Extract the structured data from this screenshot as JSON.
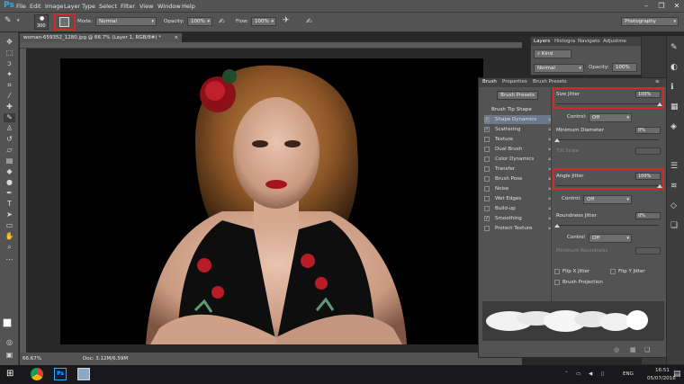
{
  "app": {
    "logo": "Ps",
    "workspace": "Photography",
    "accent": "#31a8ff"
  },
  "menu": [
    "File",
    "Edit",
    "Image",
    "Layer",
    "Type",
    "Select",
    "Filter",
    "View",
    "Window",
    "Help"
  ],
  "window_controls": {
    "minimize": "–",
    "restore": "❐",
    "close": "✕"
  },
  "options": {
    "brush_size": "300",
    "mode_label": "Mode:",
    "mode_value": "Normal",
    "opacity_label": "Opacity:",
    "opacity_value": "100%",
    "flow_label": "Flow:",
    "flow_value": "100%"
  },
  "document": {
    "tab_title": "woman-659352_1280.jpg @ 66.7% (Layer 1, RGB/8#) *",
    "tab_close": "×",
    "zoom": "66.67%",
    "doc_info": "Doc: 3.12M/6.59M"
  },
  "layers_panel": {
    "tabs": [
      "Layers",
      "Histogra",
      "Navigato",
      "Adjustme"
    ],
    "kind_label": "Kind",
    "blend_value": "Normal",
    "opacity_label": "Opacity:",
    "opacity_value": "100%"
  },
  "brush_panel": {
    "tabs": [
      "Brush",
      "Properties",
      "Brush Presets"
    ],
    "presets_button": "Brush Presets",
    "tip_shape_label": "Brush Tip Shape",
    "options": [
      {
        "label": "Shape Dynamics",
        "checked": "✓"
      },
      {
        "label": "Scattering",
        "checked": "✓"
      },
      {
        "label": "Texture",
        "checked": ""
      },
      {
        "label": "Dual Brush",
        "checked": ""
      },
      {
        "label": "Color Dynamics",
        "checked": ""
      },
      {
        "label": "Transfer",
        "checked": ""
      },
      {
        "label": "Brush Pose",
        "checked": ""
      },
      {
        "label": "Noise",
        "checked": ""
      },
      {
        "label": "Wet Edges",
        "checked": ""
      },
      {
        "label": "Build-up",
        "checked": ""
      },
      {
        "label": "Smoothing",
        "checked": "✓"
      },
      {
        "label": "Protect Texture",
        "checked": ""
      }
    ],
    "size_jitter_label": "Size Jitter",
    "size_jitter_value": "100%",
    "control_label": "Control:",
    "control_value": "Off",
    "min_diameter_label": "Minimum Diameter",
    "min_diameter_value": "0%",
    "tilt_scale_label": "Tilt Scale",
    "angle_jitter_label": "Angle Jitter",
    "angle_jitter_value": "100%",
    "angle_control_label": "Control:",
    "angle_control_value": "Off",
    "roundness_jitter_label": "Roundness Jitter",
    "roundness_jitter_value": "0%",
    "roundness_control_label": "Control",
    "roundness_control_value": "Off",
    "min_roundness_label": "Minimum Roundness",
    "flip_x_label": "Flip X Jitter",
    "flip_y_label": "Flip Y Jitter",
    "projection_label": "Brush Projection"
  },
  "taskbar": {
    "language": "ENG",
    "time": "16:51",
    "date": "05/07/2016"
  }
}
